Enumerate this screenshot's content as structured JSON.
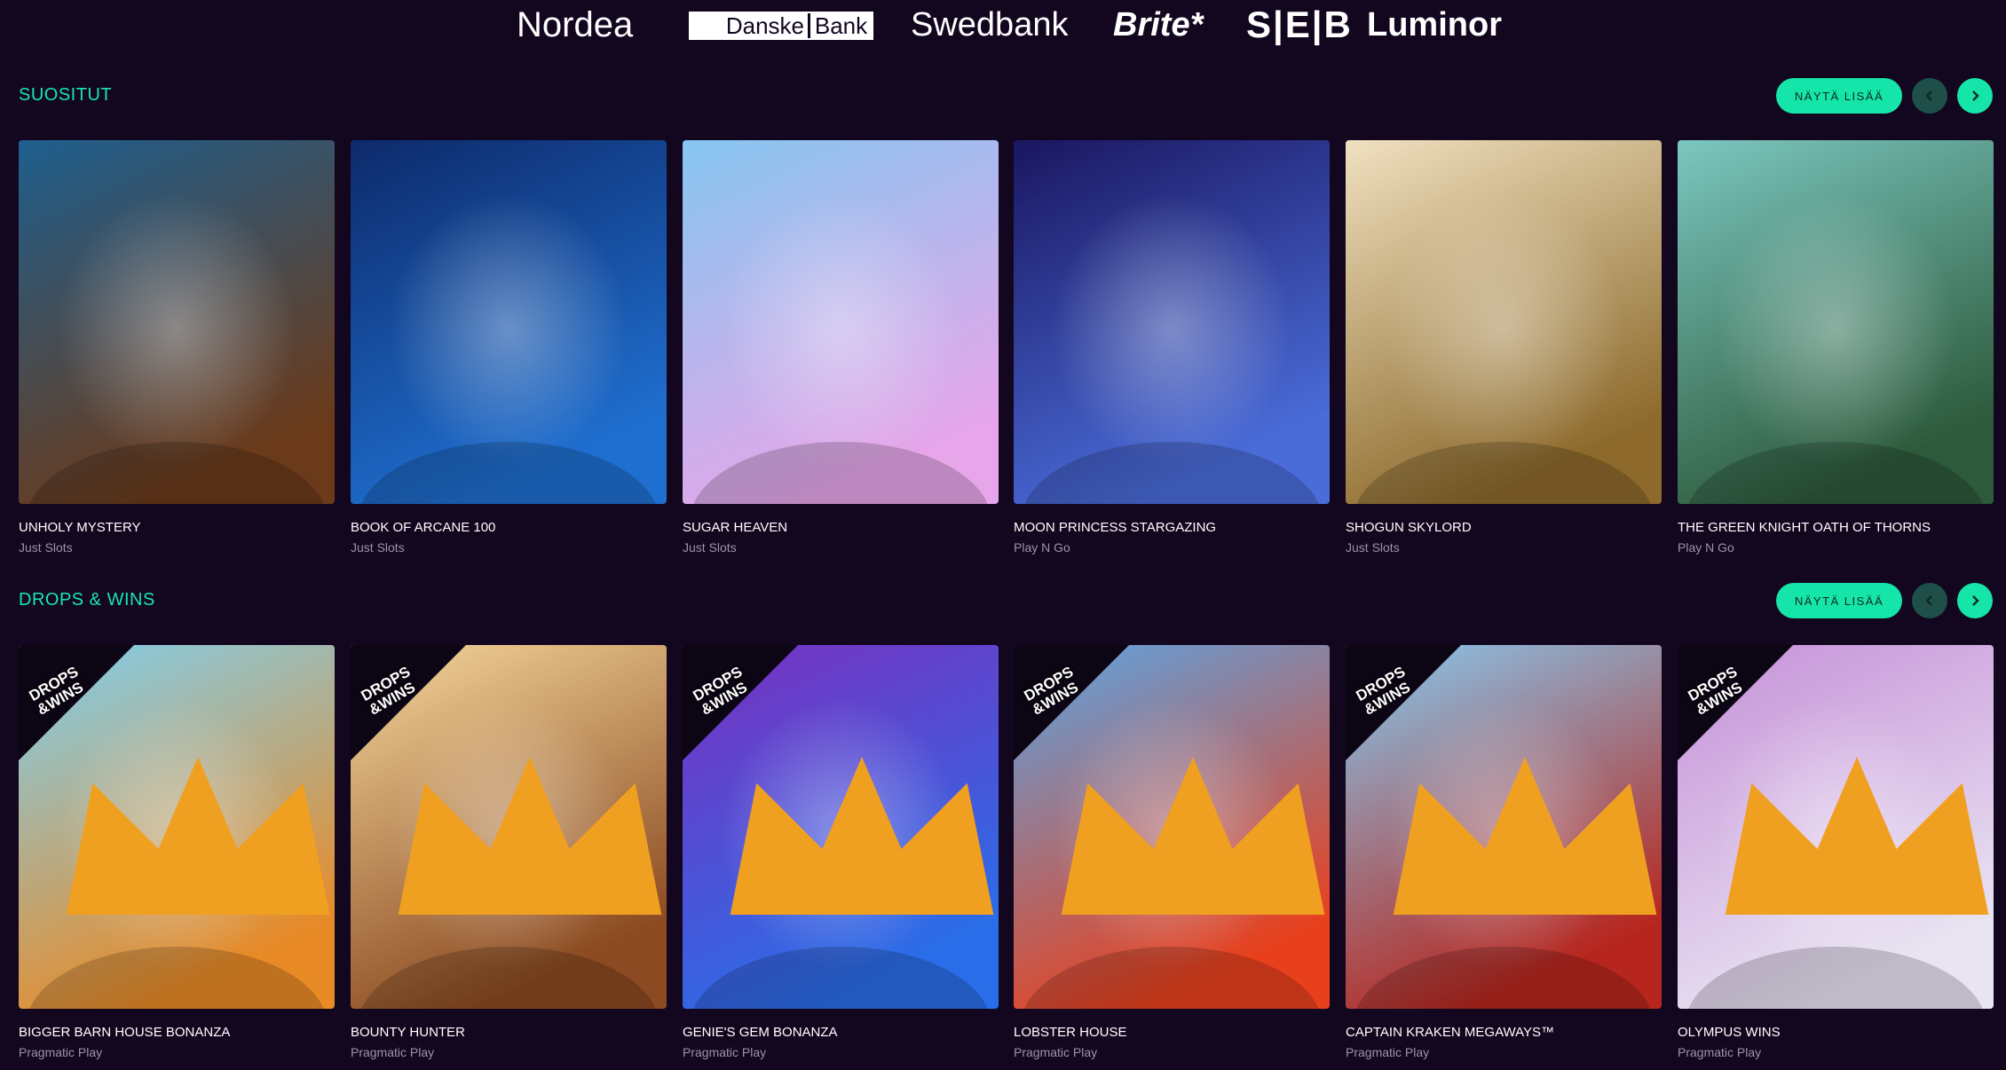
{
  "banks": {
    "nordea": "Nordea",
    "danske_1": "Danske",
    "danske_2": "Bank",
    "swedbank": "Swedbank",
    "brite": "Brite*",
    "seb": "S|E|B",
    "luminor": "Luminor"
  },
  "sections": [
    {
      "title": "SUOSITUT",
      "more_label": "NÄYTÄ LISÄÄ",
      "games": [
        {
          "title": "UNHOLY MYSTERY",
          "provider": "Just Slots",
          "colors": [
            "#1e5f8f",
            "#6b3a1a"
          ]
        },
        {
          "title": "BOOK OF ARCANE 100",
          "provider": "Just Slots",
          "colors": [
            "#0d2a6b",
            "#1f6fd0"
          ]
        },
        {
          "title": "SUGAR HEAVEN",
          "provider": "Just Slots",
          "colors": [
            "#86c6f0",
            "#e6a6e9"
          ]
        },
        {
          "title": "MOON PRINCESS STARGAZING",
          "provider": "Play N Go",
          "colors": [
            "#1a1660",
            "#4a6cd9"
          ]
        },
        {
          "title": "SHOGUN SKYLORD",
          "provider": "Just Slots",
          "colors": [
            "#f0e1c0",
            "#8d6a2c"
          ]
        },
        {
          "title": "THE GREEN KNIGHT OATH OF THORNS",
          "provider": "Play N Go",
          "colors": [
            "#7bc7c0",
            "#2d5a3b"
          ]
        }
      ]
    },
    {
      "title": "DROPS & WINS",
      "more_label": "NÄYTÄ LISÄÄ",
      "badge_1": "DROPS",
      "badge_2": "&WINS",
      "games": [
        {
          "title": "BIGGER BARN HOUSE BONANZA",
          "provider": "Pragmatic Play",
          "colors": [
            "#7fd0f0",
            "#e88a26"
          ]
        },
        {
          "title": "BOUNTY HUNTER",
          "provider": "Pragmatic Play",
          "colors": [
            "#f6d89c",
            "#8b4a21"
          ]
        },
        {
          "title": "GENIE'S GEM BONANZA",
          "provider": "Pragmatic Play",
          "colors": [
            "#7a2fc0",
            "#2a6de8"
          ]
        },
        {
          "title": "LOBSTER HOUSE",
          "provider": "Pragmatic Play",
          "colors": [
            "#5aa6e6",
            "#e8401c"
          ]
        },
        {
          "title": "CAPTAIN KRAKEN MEGAWAYS™",
          "provider": "Pragmatic Play",
          "colors": [
            "#86c9ef",
            "#b7261e"
          ]
        },
        {
          "title": "OLYMPUS WINS",
          "provider": "Pragmatic Play",
          "colors": [
            "#c590d8",
            "#e9e4f2"
          ]
        }
      ]
    }
  ]
}
